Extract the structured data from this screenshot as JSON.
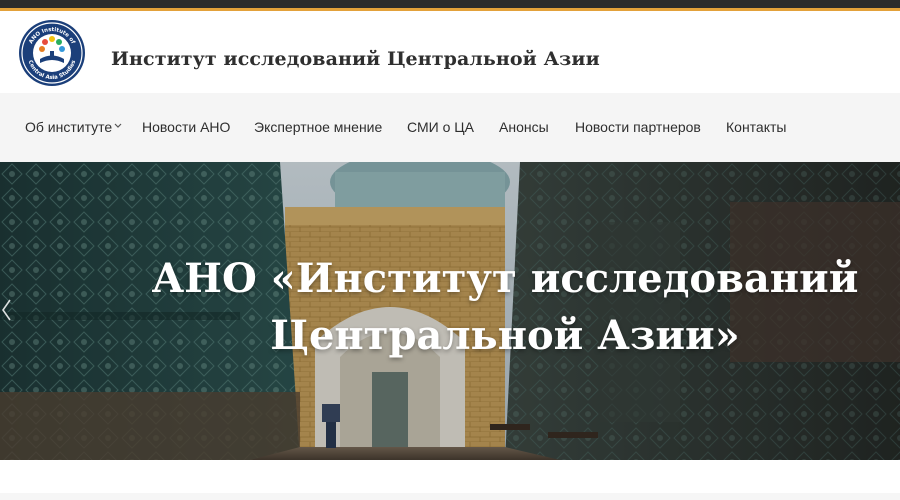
{
  "site": {
    "title": "Институт исследований Центральной Азии",
    "logo_text_top": "ANO Institute of",
    "logo_text_bottom": "Central Asia Studies",
    "accent_color": "#e3a13a",
    "logo_color": "#1b3f7a"
  },
  "nav": {
    "items": [
      {
        "label": "Об институте",
        "has_dropdown": true
      },
      {
        "label": "Новости АНО"
      },
      {
        "label": "Экспертное мнение"
      },
      {
        "label": "СМИ о ЦА"
      },
      {
        "label": "Анонсы"
      },
      {
        "label": "Новости партнеров"
      },
      {
        "label": "Контакты"
      }
    ]
  },
  "hero": {
    "title_line1": "АНО «Институт исследований",
    "title_line2": "Центральной Азии»",
    "prev_icon": "chevron-left-icon"
  }
}
